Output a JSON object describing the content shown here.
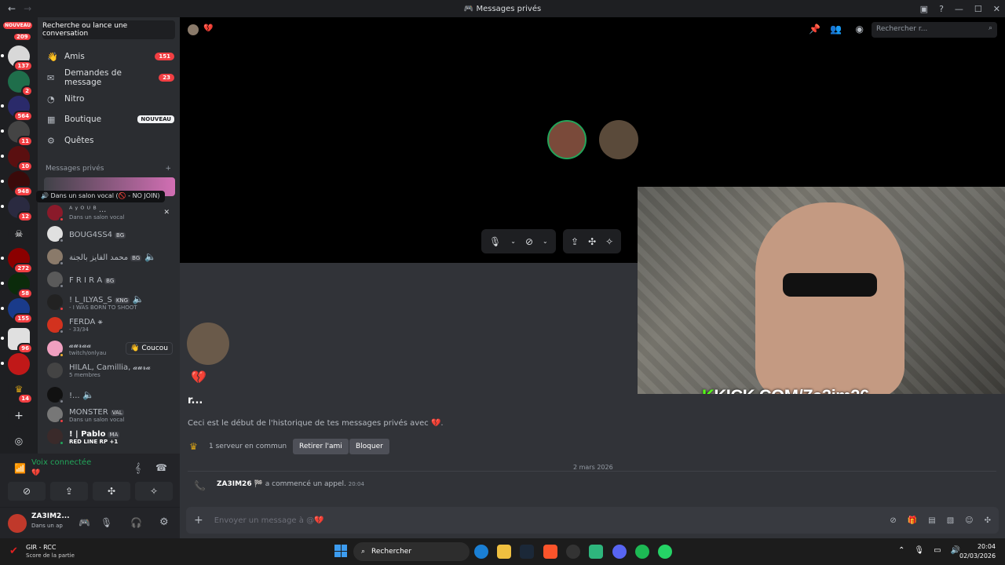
{
  "window": {
    "title": "Messages privés"
  },
  "guilds": {
    "top_badge": "NOUVEAU",
    "badges": [
      "209",
      "137",
      "2",
      "564",
      "11",
      "10",
      "948",
      "12",
      "272",
      "58",
      "155",
      "96",
      "14"
    ]
  },
  "sidebar": {
    "search_label": "Recherche ou lance une conversation",
    "nav": [
      {
        "label": "Amis",
        "badge": "151"
      },
      {
        "label": "Demandes de message",
        "badge": "23"
      },
      {
        "label": "Nitro",
        "badge": ""
      },
      {
        "label": "Boutique",
        "badge": "NOUVEAU"
      },
      {
        "label": "Quêtes",
        "badge": ""
      }
    ],
    "dm_header": "Messages privés",
    "tooltip": "Dans un salon vocal (🚫 - NO JOIN)",
    "dms": [
      {
        "name": "ᴬ ʸ ᴼ ᵁ ᴮ ...",
        "sub": "Dans un salon vocal",
        "tag": ""
      },
      {
        "name": "BOUG4SS4",
        "sub": "",
        "tag": "BG"
      },
      {
        "name": "محمد الفايز بالجنة",
        "sub": "",
        "tag": "BG"
      },
      {
        "name": "F R I R A",
        "sub": "",
        "tag": "BG"
      },
      {
        "name": "! L_ILYAS_S",
        "sub": "- I WAS BORN TO SHOOT",
        "tag": "KNG"
      },
      {
        "name": "FERDA ⚹",
        "sub": "- 33/34",
        "tag": ""
      },
      {
        "name": "𝓪𝓾𝓻𝓪𝓪",
        "sub": "twitch/onlyau",
        "tag": ""
      },
      {
        "name": "HILAL, Camillia, 𝓪𝓾𝓻𝓪",
        "sub": "5 membres",
        "tag": ""
      },
      {
        "name": "!...",
        "sub": "",
        "tag": ""
      },
      {
        "name": "MONSTER",
        "sub": "Dans un salon vocal",
        "tag": "VAL"
      },
      {
        "name": "! | Pablo",
        "sub": "RED LINE RP +1",
        "tag": "MA"
      }
    ],
    "coucou": "Coucou"
  },
  "voice": {
    "status": "Voix connectée"
  },
  "user": {
    "name": "ZA3IM2...",
    "status": "Dans un ap"
  },
  "header": {
    "search_placeholder": "Rechercher r..."
  },
  "stream": {
    "overlay": "KICK.COM/Za3im26",
    "overlay_k": "K"
  },
  "chat": {
    "name": "r...",
    "intro": "Ceci est le début de l'historique de tes messages privés avec 💔.",
    "mutual": "1 serveur en commun",
    "remove_friend": "Retirer l'ami",
    "block": "Bloquer",
    "date": "2 mars 2026",
    "call_user": "ZA3IM26 🏁",
    "call_text": "a commencé un appel.",
    "call_time": "20:04",
    "input_placeholder": "Envoyer un message à @💔"
  },
  "taskbar": {
    "game_title": "GIR - RCC",
    "game_sub": "Score de la partie",
    "search": "Rechercher",
    "time": "20:04",
    "date": "02/03/2026"
  },
  "colors": {
    "accent": "#5865f2",
    "red": "#f23f43",
    "green": "#23a55a"
  }
}
